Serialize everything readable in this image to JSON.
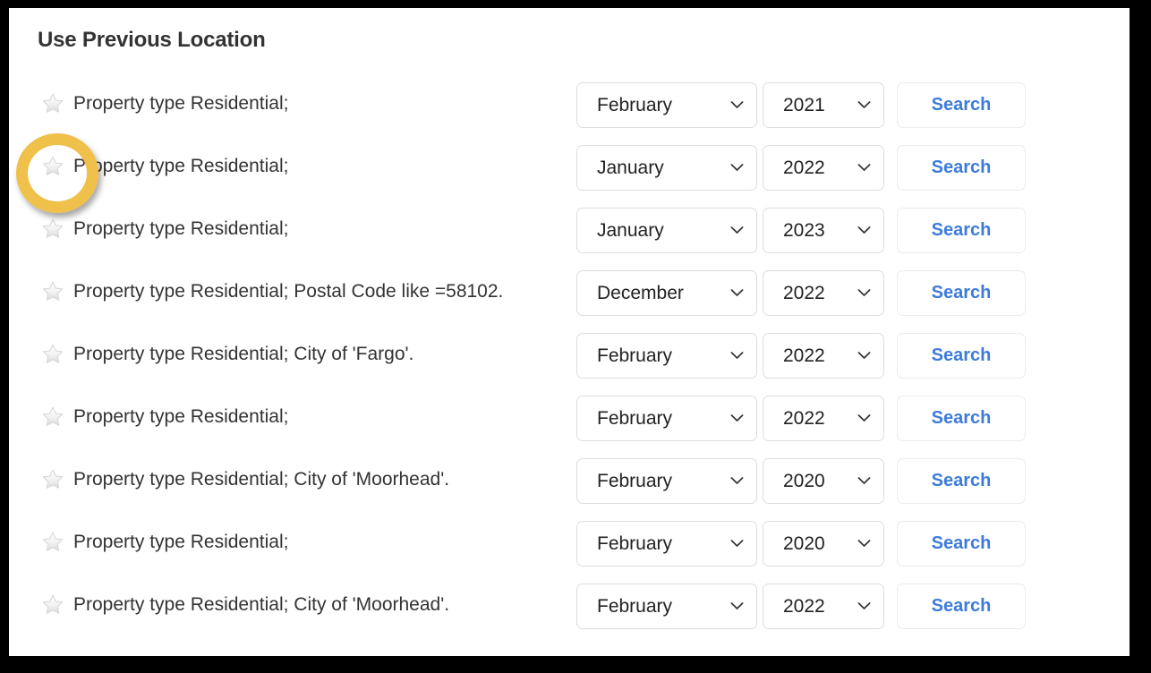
{
  "page": {
    "title": "Use Previous Location"
  },
  "icons": {
    "favorite_star": "star-icon",
    "chevron": "chevron-down-icon"
  },
  "controls": {
    "search_label": "Search"
  },
  "colors": {
    "accent_link": "#3d7bd9",
    "highlight_ring": "#efc04a",
    "title_text": "#333333",
    "border": "#dddddd",
    "page_background": "#ffffff",
    "frame": "#000000"
  },
  "annotation": {
    "type": "highlight-ring",
    "target": "favorite-star-row-2",
    "color": "#efc04a"
  },
  "rows": [
    {
      "label": "Property type Residential;",
      "month": "February",
      "year": "2021",
      "search_label": "Search"
    },
    {
      "label": "Property type Residential;",
      "month": "January",
      "year": "2022",
      "search_label": "Search"
    },
    {
      "label": "Property type Residential;",
      "month": "January",
      "year": "2023",
      "search_label": "Search"
    },
    {
      "label": "Property type Residential; Postal Code like =58102.",
      "month": "December",
      "year": "2022",
      "search_label": "Search"
    },
    {
      "label": "Property type Residential; City of 'Fargo'.",
      "month": "February",
      "year": "2022",
      "search_label": "Search"
    },
    {
      "label": "Property type Residential;",
      "month": "February",
      "year": "2022",
      "search_label": "Search"
    },
    {
      "label": "Property type Residential; City of 'Moorhead'.",
      "month": "February",
      "year": "2020",
      "search_label": "Search"
    },
    {
      "label": "Property type Residential;",
      "month": "February",
      "year": "2020",
      "search_label": "Search"
    },
    {
      "label": "Property type Residential; City of 'Moorhead'.",
      "month": "February",
      "year": "2022",
      "search_label": "Search"
    }
  ]
}
